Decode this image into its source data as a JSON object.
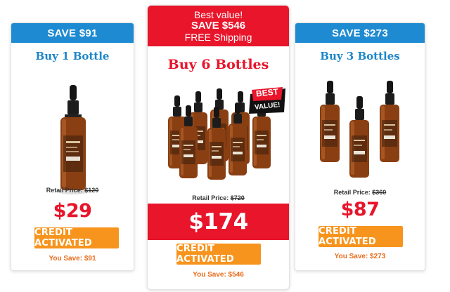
{
  "offers": {
    "left": {
      "save_banner": "SAVE $91",
      "heading": "Buy 1 Bottle",
      "retail_label": "Retail Price:",
      "retail_price": "$120",
      "price": "$29",
      "cta_label": "CREDIT ACTIVATED",
      "you_save": "You Save: $91"
    },
    "middle": {
      "banner_line1": "Best value!",
      "banner_line2": "SAVE $546",
      "banner_line3": "FREE Shipping",
      "heading": "Buy 6 Bottles",
      "badge_line1": "BEST",
      "badge_line2": "VALUE!",
      "retail_label": "Retail Price:",
      "retail_price": "$720",
      "price": "$174",
      "cta_label": "CREDIT ACTIVATED",
      "you_save": "You Save: $546"
    },
    "right": {
      "save_banner": "SAVE $273",
      "heading": "Buy 3 Bottles",
      "retail_label": "Retail Price:",
      "retail_price": "$360",
      "price": "$87",
      "cta_label": "CREDIT ACTIVATED",
      "you_save": "You Save: $273"
    }
  },
  "colors": {
    "save_banner_blue": "#1d8ad1",
    "accent_red": "#e8152b",
    "cta_orange": "#f7941d",
    "you_save_orange": "#e86b1a",
    "bottle_amber": "#8a3f12"
  },
  "icons": {
    "product": "dropper-bottle-icon",
    "badge": "best-value-badge"
  }
}
